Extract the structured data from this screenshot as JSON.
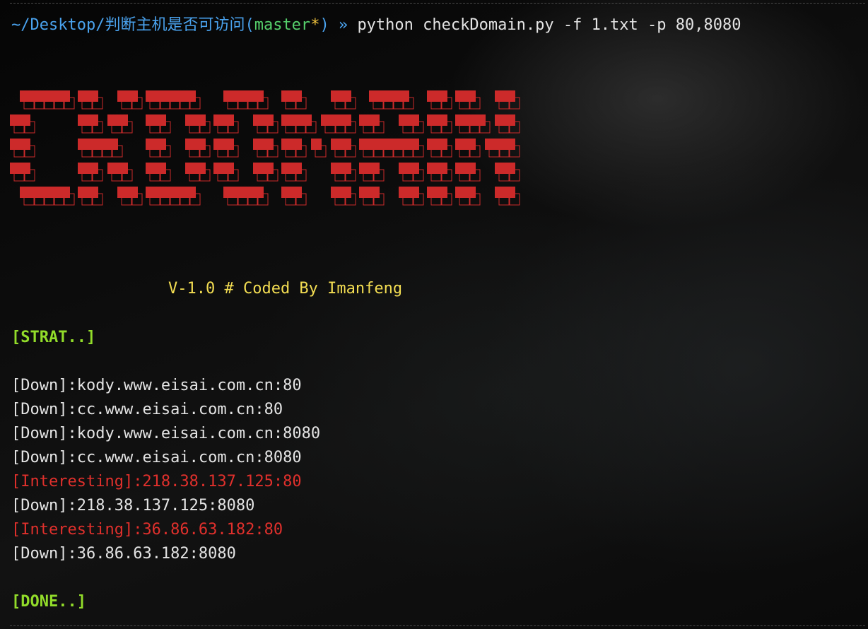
{
  "terminal": {
    "prompt": {
      "path": "~/Desktop/判断主机是否可访问",
      "branch_open": "(",
      "branch": "master",
      "dirty": "*",
      "branch_close": ")",
      "arrow": " » ",
      "command": "python checkDomain.py -f 1.txt -p 80,8080"
    },
    "banner": {
      "text": "CKDOMAIN",
      "color": "#cc2a2a"
    },
    "version_line": "V-1.0 # Coded By Imanfeng",
    "start_marker": "[STRAT..]",
    "results": [
      {
        "tag": "[Down]",
        "target": ":kody.www.eisai.com.cn:80",
        "status": "down"
      },
      {
        "tag": "[Down]",
        "target": ":cc.www.eisai.com.cn:80",
        "status": "down"
      },
      {
        "tag": "[Down]",
        "target": ":kody.www.eisai.com.cn:8080",
        "status": "down"
      },
      {
        "tag": "[Down]",
        "target": ":cc.www.eisai.com.cn:8080",
        "status": "down"
      },
      {
        "tag": "[Interesting]",
        "target": ":218.38.137.125:80",
        "status": "interesting"
      },
      {
        "tag": "[Down]",
        "target": ":218.38.137.125:8080",
        "status": "down"
      },
      {
        "tag": "[Interesting]",
        "target": ":36.86.63.182:80",
        "status": "interesting"
      },
      {
        "tag": "[Down]",
        "target": ":36.86.63.182:8080",
        "status": "down"
      }
    ],
    "done_marker": "[DONE..]"
  }
}
